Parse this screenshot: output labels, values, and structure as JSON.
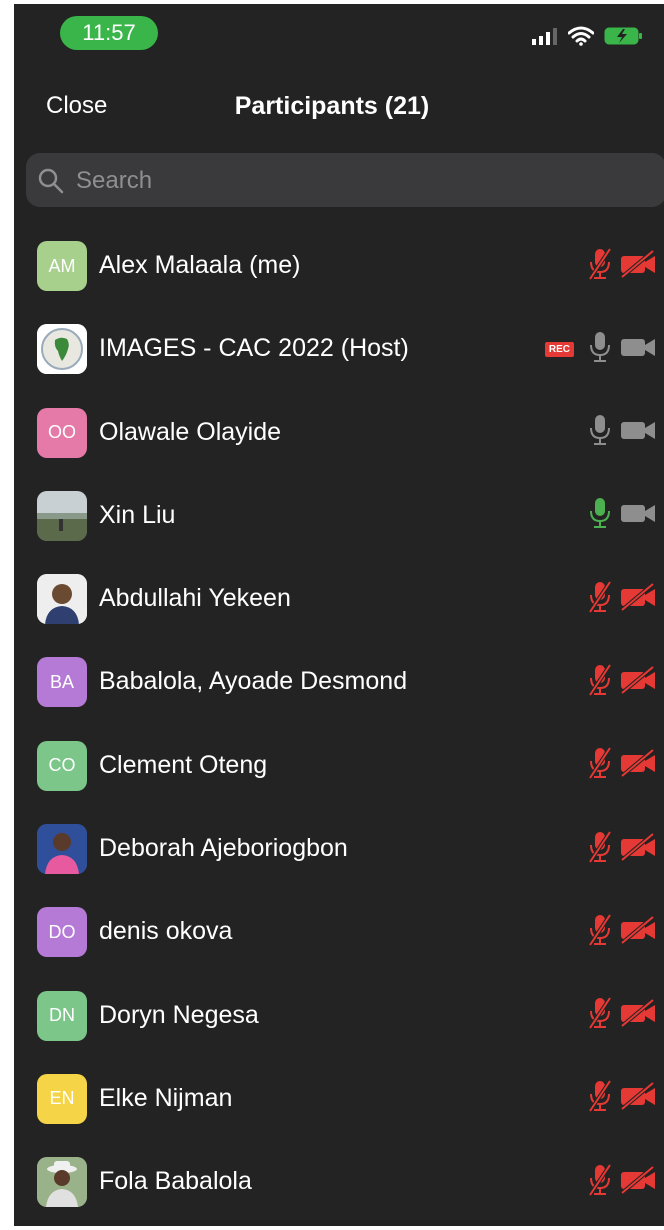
{
  "status_bar": {
    "time": "11:57"
  },
  "header": {
    "close_label": "Close",
    "title": "Participants (21)"
  },
  "search": {
    "placeholder": "Search"
  },
  "colors": {
    "background": "#232323",
    "muted_red": "#e53935",
    "speaking_green": "#4caf50",
    "gray_icon": "#8e8e8e"
  },
  "participants": [
    {
      "initials": "AM",
      "name": "Alex Malaala (me)",
      "avatar_color": "#a8d08d",
      "avatar_type": "initials",
      "mic": "muted",
      "video": "off",
      "rec": false
    },
    {
      "initials": "",
      "name": "IMAGES - CAC 2022 (Host)",
      "avatar_color": "#ffffff",
      "avatar_type": "logo",
      "mic": "on",
      "video": "on",
      "rec": true,
      "rec_label": "REC"
    },
    {
      "initials": "OO",
      "name": "Olawale Olayide",
      "avatar_color": "#e57aa8",
      "avatar_type": "initials",
      "mic": "on",
      "video": "on",
      "rec": false
    },
    {
      "initials": "",
      "name": "Xin Liu",
      "avatar_color": "#7a8a7a",
      "avatar_type": "photo-landscape",
      "mic": "speaking",
      "video": "on",
      "rec": false
    },
    {
      "initials": "",
      "name": "Abdullahi Yekeen",
      "avatar_color": "#e8e8e8",
      "avatar_type": "photo-person",
      "mic": "muted",
      "video": "off",
      "rec": false
    },
    {
      "initials": "BA",
      "name": "Babalola, Ayoade Desmond",
      "avatar_color": "#b57ad6",
      "avatar_type": "initials",
      "mic": "muted",
      "video": "off",
      "rec": false
    },
    {
      "initials": "CO",
      "name": "Clement Oteng",
      "avatar_color": "#7cc68a",
      "avatar_type": "initials",
      "mic": "muted",
      "video": "off",
      "rec": false
    },
    {
      "initials": "",
      "name": "Deborah Ajeboriogbon",
      "avatar_color": "#3b5aa8",
      "avatar_type": "photo-person-pink",
      "mic": "muted",
      "video": "off",
      "rec": false
    },
    {
      "initials": "DO",
      "name": "denis okova",
      "avatar_color": "#b57ad6",
      "avatar_type": "initials",
      "mic": "muted",
      "video": "off",
      "rec": false
    },
    {
      "initials": "DN",
      "name": "Doryn Negesa",
      "avatar_color": "#7cc68a",
      "avatar_type": "initials",
      "mic": "muted",
      "video": "off",
      "rec": false
    },
    {
      "initials": "EN",
      "name": "Elke Nijman",
      "avatar_color": "#f5d547",
      "avatar_type": "initials",
      "mic": "muted",
      "video": "off",
      "rec": false
    },
    {
      "initials": "",
      "name": "Fola Babalola",
      "avatar_color": "#8aa68a",
      "avatar_type": "photo-person-hat",
      "mic": "muted",
      "video": "off",
      "rec": false
    }
  ]
}
